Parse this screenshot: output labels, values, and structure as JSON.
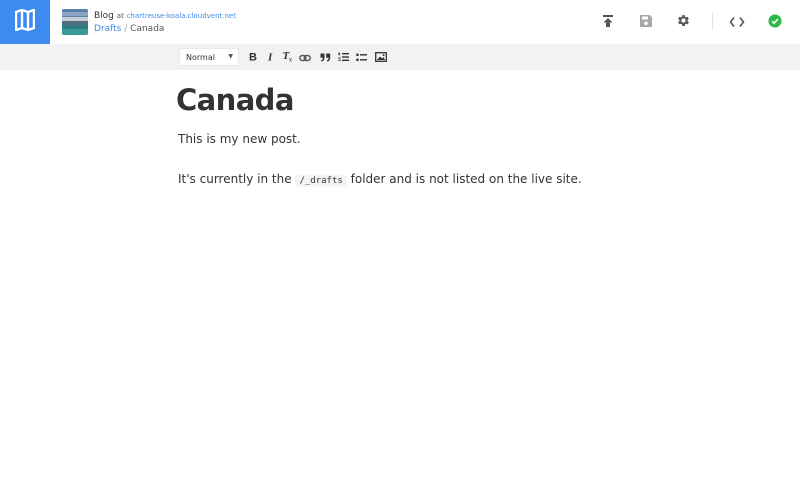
{
  "header": {
    "site_name": "Blog",
    "site_at": "at",
    "site_domain": "chartreuse-koala.cloudvent.net",
    "breadcrumb": {
      "parent": "Drafts",
      "separator": "/",
      "current": "Canada"
    },
    "icons": {
      "logo": "map-icon",
      "publish": "upload-icon",
      "save": "save-icon",
      "settings": "gear-icon",
      "source": "code-icon",
      "status": "check-circle-icon"
    },
    "colors": {
      "accent": "#3d8bf0",
      "status_ok": "#2db84c",
      "icon_gray": "#555555",
      "icon_muted": "#a8a8a8"
    }
  },
  "toolbar": {
    "format_value": "Normal",
    "buttons": [
      "bold-icon",
      "italic-icon",
      "clear-format-icon",
      "link-icon",
      "quote-icon",
      "ordered-list-icon",
      "unordered-list-icon",
      "image-icon"
    ]
  },
  "post": {
    "title": "Canada",
    "paragraph1": "This is my new post.",
    "paragraph2_before": "It's currently in the",
    "paragraph2_code": "/_drafts",
    "paragraph2_after": "folder and is not listed on the live site."
  }
}
